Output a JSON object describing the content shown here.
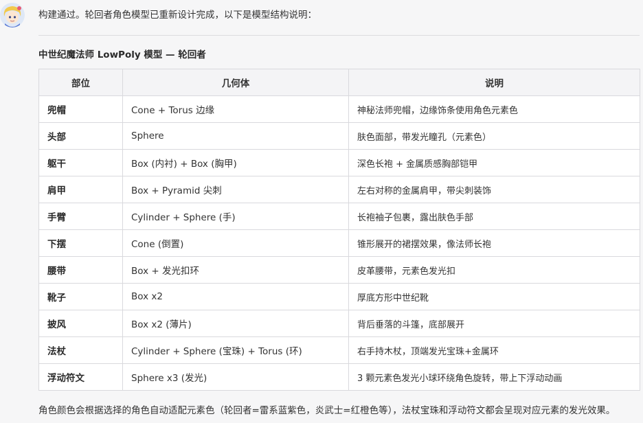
{
  "message": {
    "intro": "构建通过。轮回者角色模型已重新设计完成，以下是模型结构说明：",
    "heading": "中世纪魔法师 LowPoly 模型 — 轮回者",
    "footnote": "角色颜色会根据选择的角色自动适配元素色（轮回者=雷系蓝紫色，炎武士=红橙色等），法杖宝珠和浮动符文都会呈现对应元素的发光效果。"
  },
  "table": {
    "headers": [
      "部位",
      "几何体",
      "说明"
    ],
    "rows": [
      {
        "part": "兜帽",
        "geometry": "Cone + Torus 边缘",
        "desc": "神秘法师兜帽，边缘饰条使用角色元素色"
      },
      {
        "part": "头部",
        "geometry": "Sphere",
        "desc": "肤色面部，带发光瞳孔（元素色）"
      },
      {
        "part": "躯干",
        "geometry": "Box (内衬) + Box (胸甲)",
        "desc": "深色长袍 + 金属质感胸部铠甲"
      },
      {
        "part": "肩甲",
        "geometry": "Box + Pyramid 尖刺",
        "desc": "左右对称的金属肩甲，带尖刺装饰"
      },
      {
        "part": "手臂",
        "geometry": "Cylinder + Sphere (手)",
        "desc": "长袍袖子包裹，露出肤色手部"
      },
      {
        "part": "下摆",
        "geometry": "Cone (倒置)",
        "desc": "锥形展开的裙摆效果，像法师长袍"
      },
      {
        "part": "腰带",
        "geometry": "Box + 发光扣环",
        "desc": "皮革腰带，元素色发光扣"
      },
      {
        "part": "靴子",
        "geometry": "Box x2",
        "desc": "厚底方形中世纪靴"
      },
      {
        "part": "披风",
        "geometry": "Box x2 (薄片)",
        "desc": "背后垂落的斗篷，底部展开"
      },
      {
        "part": "法杖",
        "geometry": "Cylinder + Sphere (宝珠) + Torus (环)",
        "desc": "右手持木杖，顶端发光宝珠+金属环"
      },
      {
        "part": "浮动符文",
        "geometry": "Sphere x3 (发光)",
        "desc": "3 颗元素色发光小球环绕角色旋转，带上下浮动动画"
      }
    ]
  },
  "avatar": {
    "icon": "assistant-avatar-icon"
  }
}
